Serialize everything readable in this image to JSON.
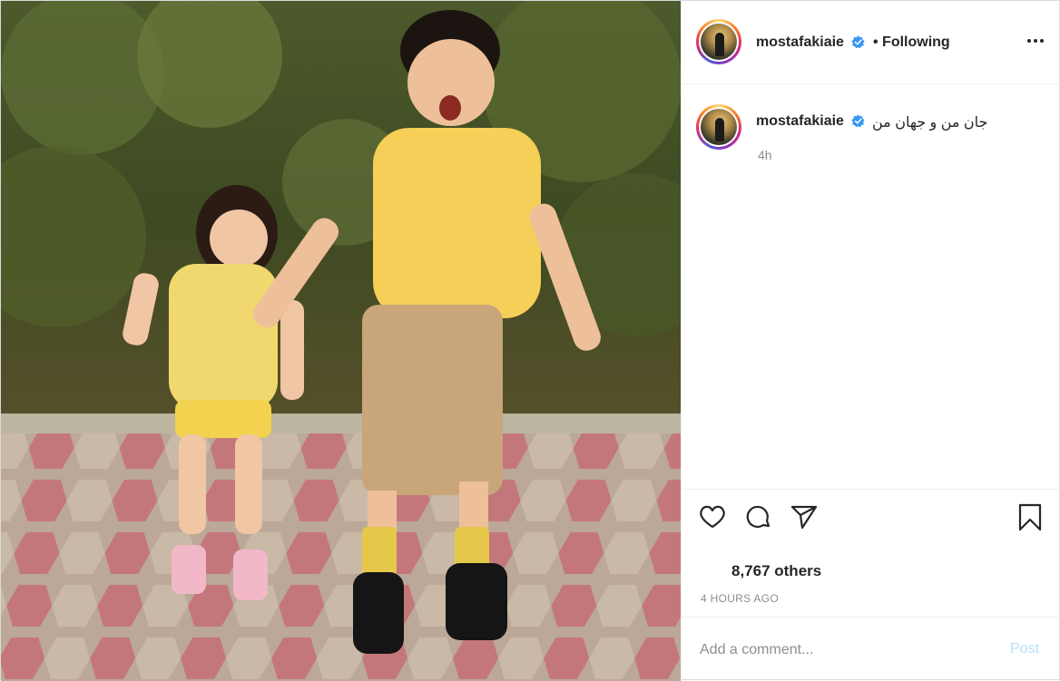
{
  "post": {
    "author": {
      "username": "mostafakiaie",
      "verified": true,
      "follow_status": "• Following"
    },
    "caption": {
      "username": "mostafakiaie",
      "text": "جان من و جهان من",
      "time": "4h"
    },
    "likes_text": "8,767 others",
    "timestamp": "4 HOURS AGO",
    "comment": {
      "placeholder": "Add a comment...",
      "post_label": "Post"
    },
    "icons": {
      "more": "more-options-icon",
      "like": "heart-icon",
      "comment": "comment-bubble-icon",
      "share": "paper-plane-icon",
      "save": "bookmark-icon",
      "verified": "verified-badge-icon"
    },
    "colors": {
      "verified": "#3897f0",
      "post_button": "#b2dffc",
      "secondary_text": "#8e8e8e"
    }
  }
}
